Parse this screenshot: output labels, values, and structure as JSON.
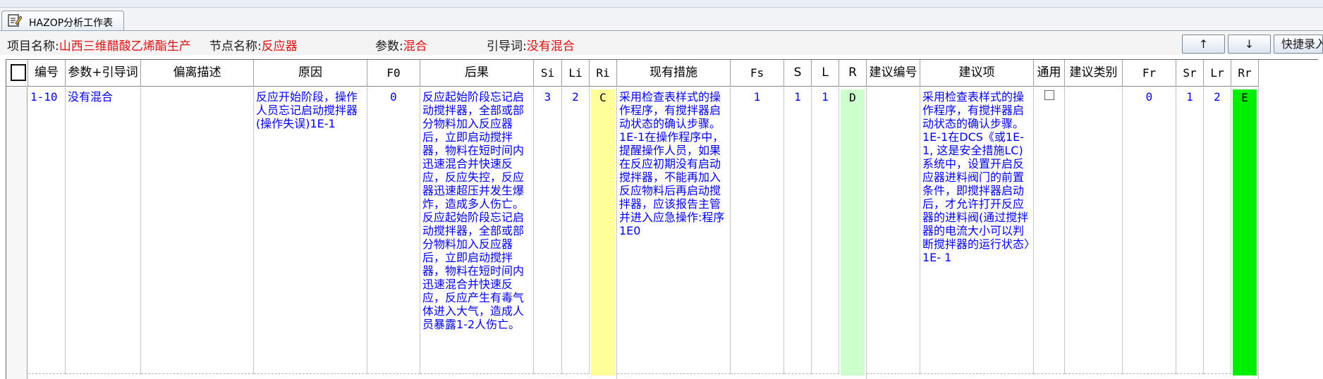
{
  "window": {
    "tab_label": "HAZOP分析工作表",
    "tab_icon": "edit-sheet-icon"
  },
  "info": {
    "project_key": "项目名称:",
    "project_value": "山西三维醋酸乙烯酯生产",
    "node_key": "节点名称:",
    "node_value": "反应器",
    "param_key": "参数:",
    "param_value": "混合",
    "guide_key": "引导词:",
    "guide_value": "没有混合"
  },
  "toolbar": {
    "up_label": "↑",
    "down_label": "↓",
    "quick_label": "快捷录入"
  },
  "colors": {
    "ri_fill": "#ffff99",
    "r_fill": "#ccffcc",
    "rr_fill": "#00ee00",
    "value_text": "#0000ee",
    "info_value": "#e01010"
  },
  "columns": [
    "编号",
    "参数+引导词",
    "偏离描述",
    "原因",
    "F0",
    "后果",
    "Si",
    "Li",
    "Ri",
    "现有措施",
    "Fs",
    "S",
    "L",
    "R",
    "建议编号",
    "建议项",
    "通用",
    "建议类别",
    "Fr",
    "Sr",
    "Lr",
    "Rr"
  ],
  "row": {
    "id": "1-10",
    "param_guide": "没有混合",
    "deviation": "",
    "cause": "反应开始阶段，操作人员忘记启动搅拌器(操作失误)1E-1",
    "f0": "0",
    "consequence": "反应起始阶段忘记启动搅拌器，全部或部分物料加入反应器后，立即启动搅拌器，物料在短时间内迅速混合并快速反应，反应失控，反应器迅速超压并发生爆炸，造成多人伤亡。反应起始阶段忘记启动搅拌器，全部或部分物料加入反应器后，立即启动搅拌器，物料在短时间内迅速混合并快速反应，反应产生有毒气体进入大气，造成人员暴露1-2人伤亡。",
    "si": "3",
    "li": "2",
    "ri": "C",
    "measures": "采用检查表样式的操作程序，有搅拌器启动状态的确认步骤。1E-1在操作程序中，提醒操作人员，如果在反应初期没有启动搅拌器，不能再加入反应物料后再启动搅拌器，应该报告主管并进入应急操作:程序1E0",
    "fs": "1",
    "s": "1",
    "l": "1",
    "r": "D",
    "rec_no": "",
    "rec": "采用检查表样式的操作程序，有搅拌器启动状态的确认步骤。1E-1在DCS《或1E-1, 这是安全措施LC)系统中，设置开启反应器进料阀门的前置条件，即搅拌器启动后，才允许打开反应器的进料阀(通过搅拌器的电流大小可以判断搅拌器的运行状态〉1E- 1",
    "common": false,
    "rec_type": "",
    "fr": "0",
    "sr": "1",
    "lr": "2",
    "rr": "E"
  }
}
